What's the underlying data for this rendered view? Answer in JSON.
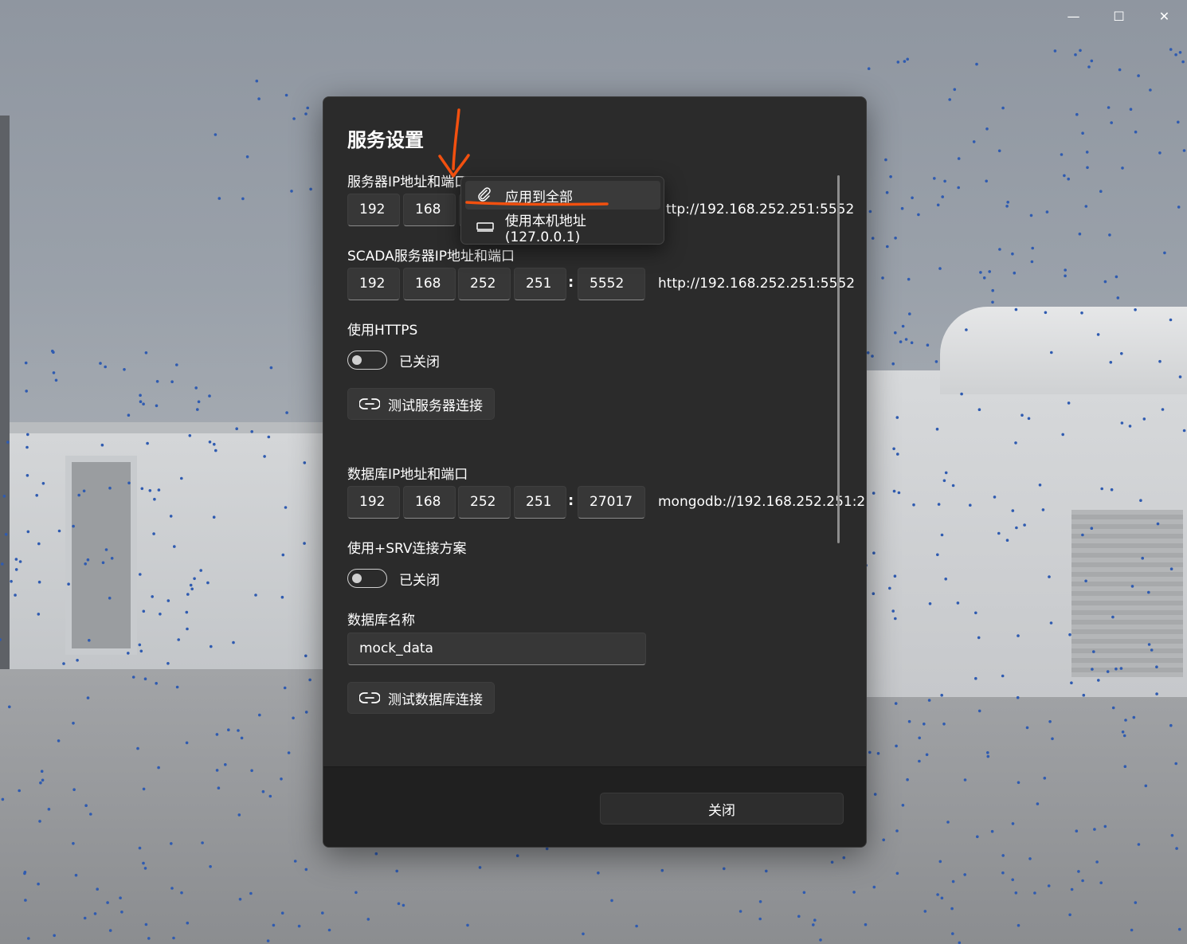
{
  "window": {
    "minimize_glyph": "—",
    "maximize_glyph": "☐",
    "close_glyph": "✕"
  },
  "dialog": {
    "title": "服务设置",
    "server": {
      "label": "服务器IP地址和端口",
      "ip": [
        "192",
        "168"
      ],
      "url": "ttp://192.168.252.251:5552"
    },
    "scada": {
      "label": "SCADA服务器IP地址和端口",
      "ip": [
        "192",
        "168",
        "252",
        "251"
      ],
      "port": "5552",
      "url": "http://192.168.252.251:5552"
    },
    "https": {
      "label": "使用HTTPS",
      "state": "已关闭"
    },
    "test_server_button": "测试服务器连接",
    "database": {
      "label": "数据库IP地址和端口",
      "ip": [
        "192",
        "168",
        "252",
        "251"
      ],
      "port": "27017",
      "url": "mongodb://192.168.252.251:2"
    },
    "srv": {
      "label": "使用+SRV连接方案",
      "state": "已关闭"
    },
    "db_name": {
      "label": "数据库名称",
      "value": "mock_data"
    },
    "test_db_button": "测试数据库连接",
    "close_button": "关闭"
  },
  "context_menu": {
    "items": [
      {
        "label": "应用到全部",
        "icon": "paperclip-icon"
      },
      {
        "label": "使用本机地址(127.0.0.1)",
        "icon": "local-computer-icon"
      }
    ]
  },
  "colors": {
    "annotation": "#f2500f",
    "dialog_bg": "#2b2b2b",
    "footer_bg": "#202020"
  }
}
